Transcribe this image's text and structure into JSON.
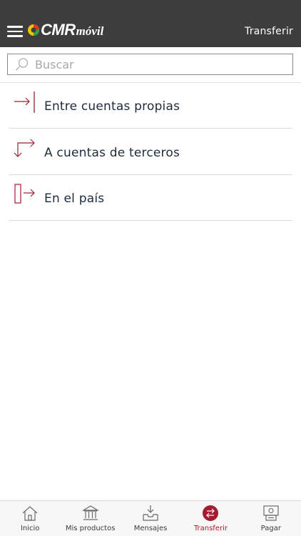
{
  "header": {
    "logo_text": "CMR",
    "logo_sub": "móvil",
    "title": "Transferir"
  },
  "search": {
    "placeholder": "Buscar",
    "value": ""
  },
  "options": [
    {
      "label": "Entre cuentas propias",
      "icon": "arrow-into-bar-icon"
    },
    {
      "label": "A cuentas de terceros",
      "icon": "arrow-turn-icon"
    },
    {
      "label": "En el país",
      "icon": "arrow-out-of-box-icon"
    }
  ],
  "tabbar": {
    "items": [
      {
        "label": "Inicio",
        "icon": "home-icon"
      },
      {
        "label": "Mis productos",
        "icon": "bank-icon"
      },
      {
        "label": "Mensajes",
        "icon": "inbox-icon"
      },
      {
        "label": "Transferir",
        "icon": "transfer-icon",
        "active": true
      },
      {
        "label": "Pagar",
        "icon": "payment-icon"
      }
    ]
  },
  "colors": {
    "header_bg": "#3d3d3d",
    "accent": "#a51c30",
    "text": "#1e2b3c"
  }
}
